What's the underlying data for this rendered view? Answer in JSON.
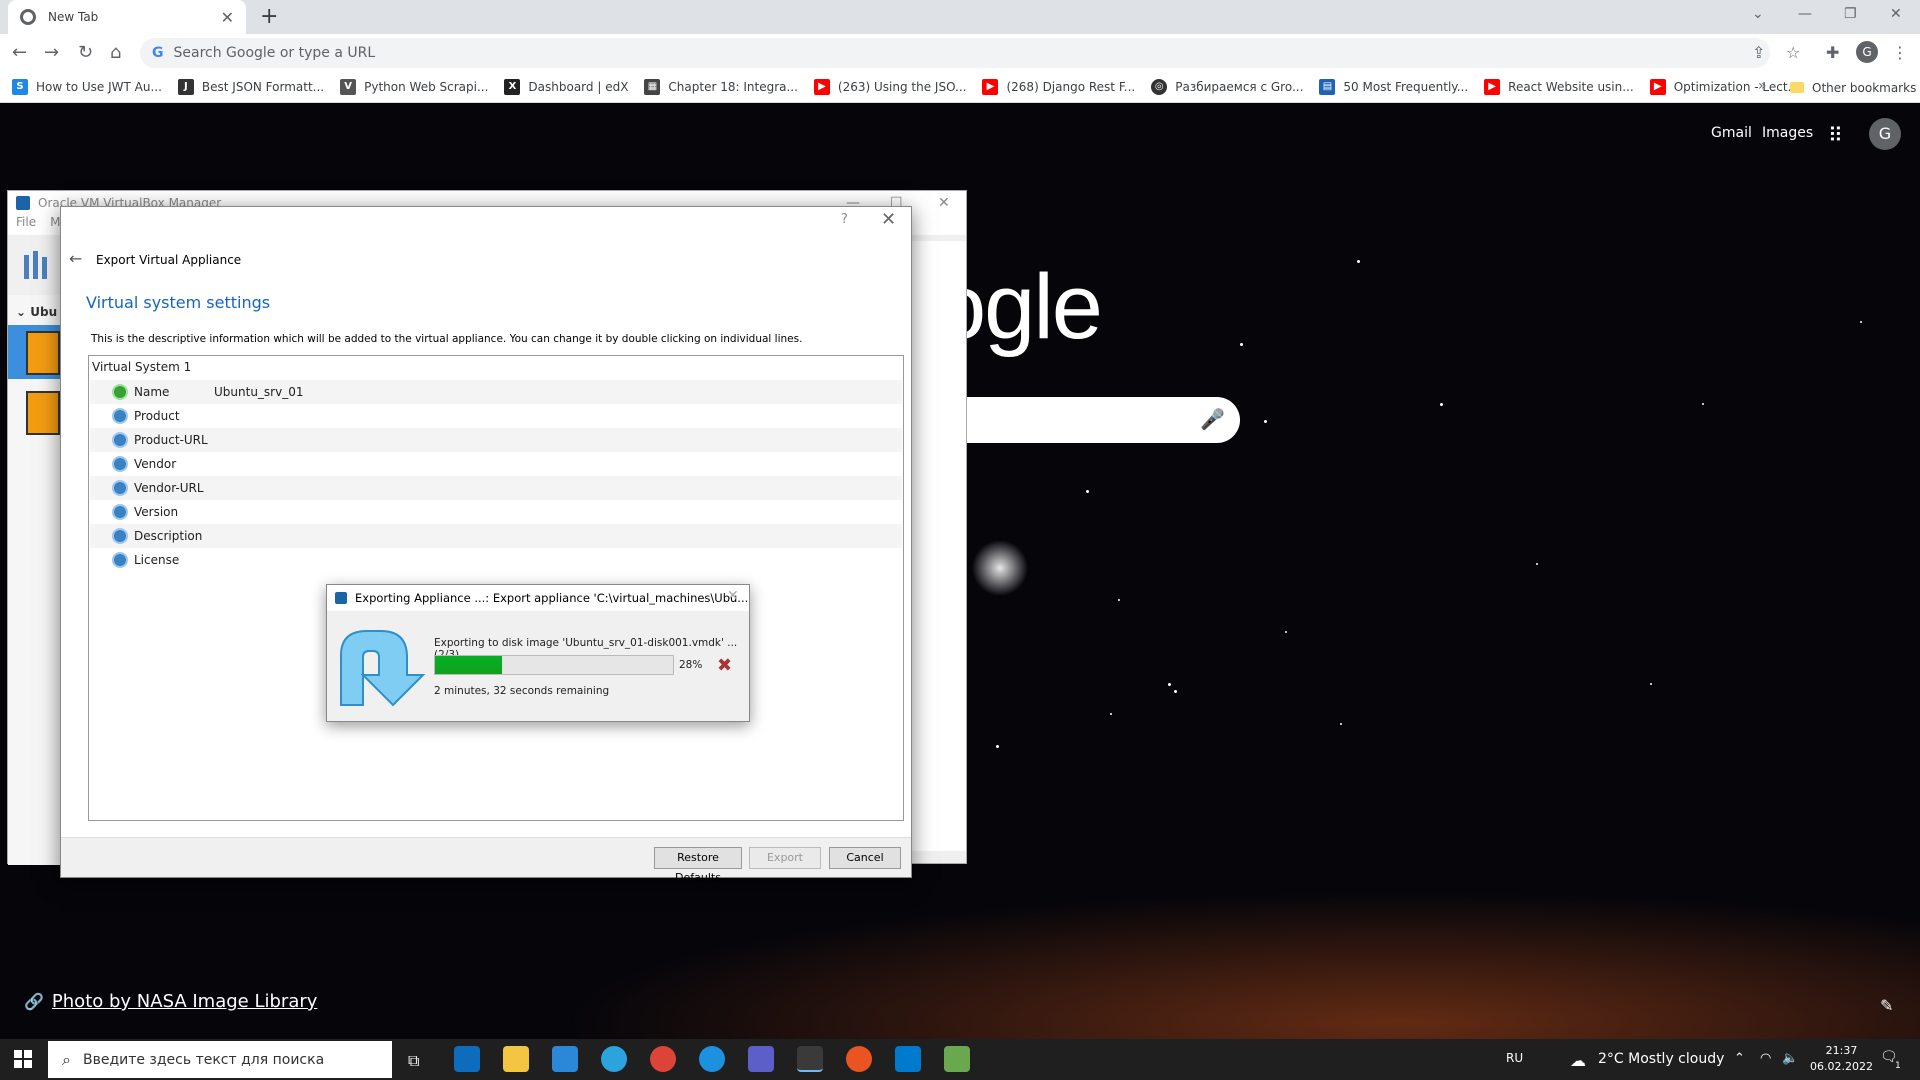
{
  "browser": {
    "tab_title": "New Tab",
    "omnibox_placeholder": "Search Google or type a URL",
    "profile_initial": "G",
    "bookmarks": [
      {
        "label": "How to Use JWT Au...",
        "color": "#1e88e5"
      },
      {
        "label": "Best JSON Formatt...",
        "color": "#333333"
      },
      {
        "label": "Python Web Scrapi...",
        "color": "#555555"
      },
      {
        "label": "Dashboard | edX",
        "color": "#222222"
      },
      {
        "label": "Chapter 18: Integra...",
        "color": "#444444"
      },
      {
        "label": "(263) Using the JSO...",
        "color": "#ff0000"
      },
      {
        "label": "(268) Django Rest F...",
        "color": "#ff0000"
      },
      {
        "label": "Разбираемся с Gro...",
        "color": "#333333"
      },
      {
        "label": "50 Most Frequently...",
        "color": "#1e63b5"
      },
      {
        "label": "React Website usin...",
        "color": "#ff0000"
      },
      {
        "label": "Optimization - Lect...",
        "color": "#ff0000"
      }
    ],
    "other_bookmarks": "Other bookmarks"
  },
  "google": {
    "gmail": "Gmail",
    "images": "Images",
    "avatar": "G",
    "logo_fragment": "ogle",
    "photo_credit": "Photo by NASA Image Library"
  },
  "vbox_manager": {
    "title": "Oracle VM VirtualBox Manager",
    "menu": [
      "File",
      "M"
    ],
    "group_label": "Ubu"
  },
  "export_dialog": {
    "help": "?",
    "wizard_title": "Export Virtual Appliance",
    "section_title": "Virtual system settings",
    "description": "This is the descriptive information which will be added to the virtual appliance. You can change it by double clicking on individual lines.",
    "tree_root": "Virtual System 1",
    "rows": [
      {
        "key": "Name",
        "value": "Ubuntu_srv_01"
      },
      {
        "key": "Product",
        "value": ""
      },
      {
        "key": "Product-URL",
        "value": ""
      },
      {
        "key": "Vendor",
        "value": ""
      },
      {
        "key": "Vendor-URL",
        "value": ""
      },
      {
        "key": "Version",
        "value": ""
      },
      {
        "key": "Description",
        "value": ""
      },
      {
        "key": "License",
        "value": ""
      }
    ],
    "buttons": {
      "restore": "Restore Defaults",
      "export": "Export",
      "cancel": "Cancel"
    }
  },
  "progress_dialog": {
    "title": "Exporting Appliance ...: Export appliance 'C:\\virtual_machines\\Ubu...",
    "message": "Exporting to disk image 'Ubuntu_srv_01-disk001.vmdk' ... (2/3)",
    "percent": 28,
    "percent_label": "28%",
    "remaining": "2 minutes, 32 seconds remaining"
  },
  "taskbar": {
    "search_placeholder": "Введите здесь текст для поиска",
    "lang": "RU",
    "weather": "2°C  Mostly cloudy",
    "time": "21:37",
    "date": "06.02.2022",
    "notification_count": "1"
  }
}
